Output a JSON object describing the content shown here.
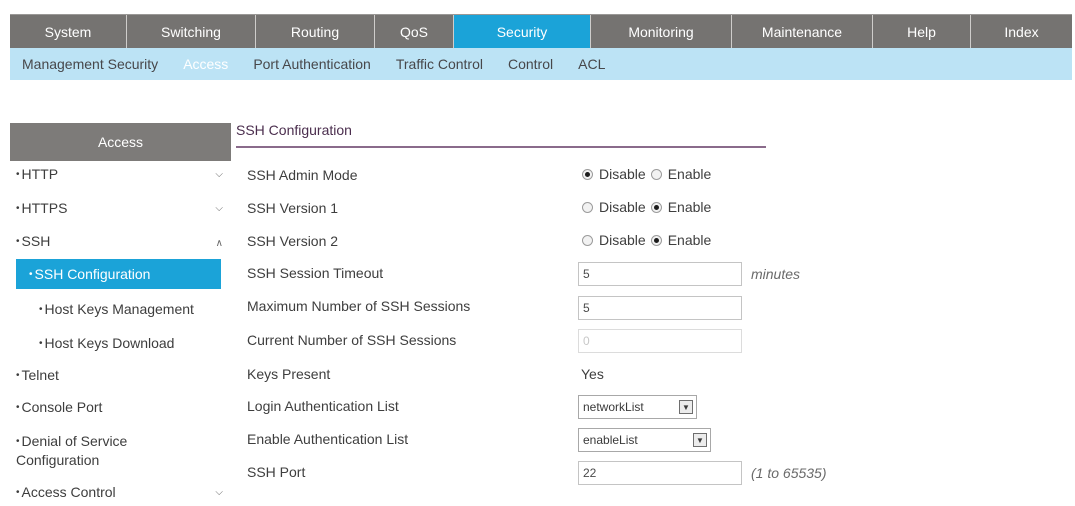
{
  "top_nav": [
    {
      "label": "System"
    },
    {
      "label": "Switching"
    },
    {
      "label": "Routing"
    },
    {
      "label": "QoS"
    },
    {
      "label": "Security"
    },
    {
      "label": "Monitoring"
    },
    {
      "label": "Maintenance"
    },
    {
      "label": "Help"
    },
    {
      "label": "Index"
    }
  ],
  "sub_nav": [
    {
      "label": "Management Security"
    },
    {
      "label": "Access"
    },
    {
      "label": "Port Authentication"
    },
    {
      "label": "Traffic Control"
    },
    {
      "label": "Control"
    },
    {
      "label": "ACL"
    }
  ],
  "sidebar": {
    "header": "Access",
    "items": [
      {
        "label": "HTTP"
      },
      {
        "label": "HTTPS"
      },
      {
        "label": "SSH"
      },
      {
        "label": "SSH Configuration"
      },
      {
        "label": "Host Keys Management"
      },
      {
        "label": "Host Keys Download"
      },
      {
        "label": "Telnet"
      },
      {
        "label": "Console Port"
      },
      {
        "label": "Denial of Service"
      },
      {
        "label": "Configuration"
      },
      {
        "label": "Access Control"
      }
    ]
  },
  "content": {
    "section_title": "SSH Configuration",
    "rows": {
      "admin_mode": {
        "label": "SSH Admin Mode",
        "opt1": "Disable",
        "opt2": "Enable",
        "selected": "Disable"
      },
      "version1": {
        "label": "SSH Version 1",
        "opt1": "Disable",
        "opt2": "Enable",
        "selected": "Enable"
      },
      "version2": {
        "label": "SSH Version 2",
        "opt1": "Disable",
        "opt2": "Enable",
        "selected": "Enable"
      },
      "session_timeout": {
        "label": "SSH Session Timeout",
        "value": "5",
        "unit": "minutes"
      },
      "max_sessions": {
        "label": "Maximum Number of SSH Sessions",
        "value": "5"
      },
      "current_sessions": {
        "label": "Current Number of SSH Sessions",
        "value": "0"
      },
      "keys_present": {
        "label": "Keys Present",
        "value": "Yes"
      },
      "login_auth": {
        "label": "Login Authentication List",
        "value": "networkList"
      },
      "enable_auth": {
        "label": "Enable Authentication List",
        "value": "enableList"
      },
      "ssh_port": {
        "label": "SSH Port",
        "value": "22",
        "range": "(1 to 65535)"
      }
    }
  },
  "colors": {
    "nav_bg": "#757371",
    "accent": "#1ba3d8",
    "subnav_bg": "#bce3f5"
  }
}
